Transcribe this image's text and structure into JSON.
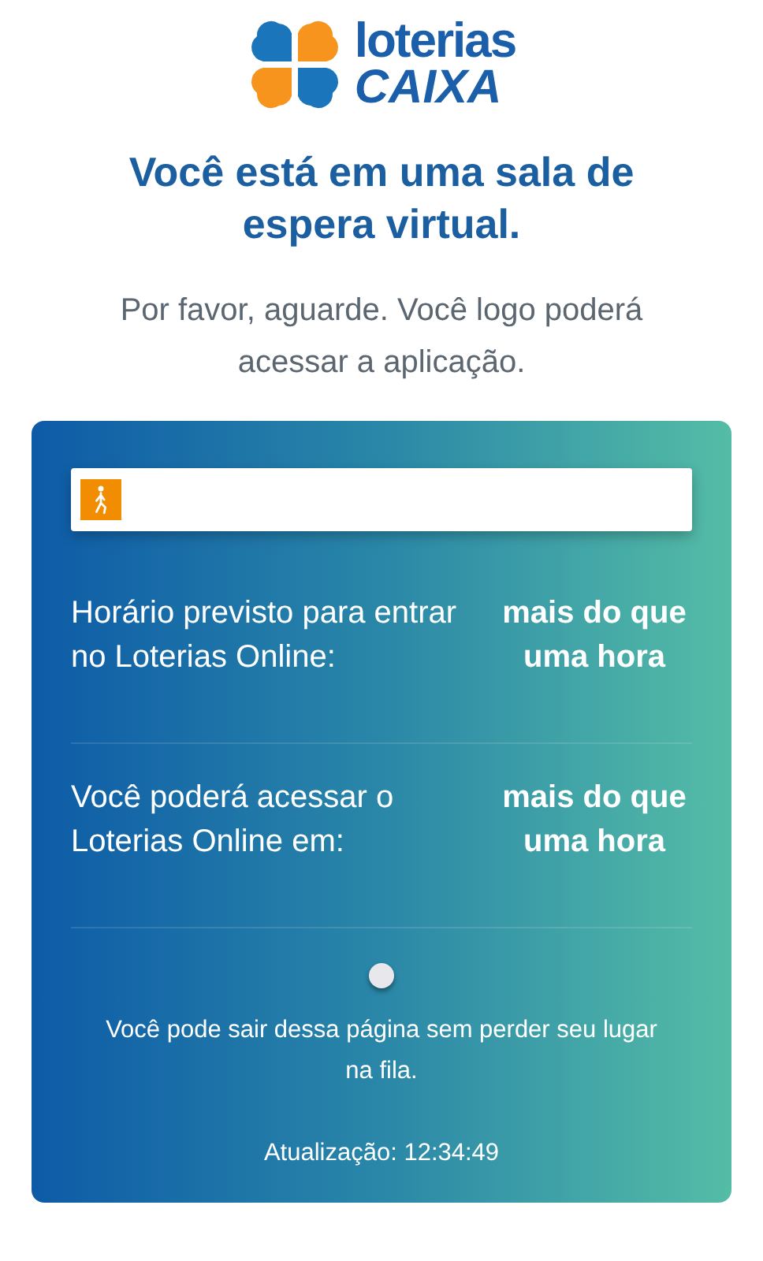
{
  "logo": {
    "line_1": "loterias",
    "line_2": "CAIXA"
  },
  "title": "Você está em uma sala de espera virtual.",
  "subtitle": "Por favor, aguarde. Você logo poderá acessar a aplicação.",
  "queue": {
    "progress": {
      "level": 0
    },
    "rows": [
      {
        "label": "Horário previsto para entrar no Loterias Online:",
        "value": "mais do que uma hora"
      },
      {
        "label": "Você poderá acessar o Loterias Online em:",
        "value": "mais do que uma hora"
      }
    ],
    "note": "Você pode sair dessa página sem perder seu lugar na fila.",
    "updated": "Atualização: 12:34:49"
  }
}
